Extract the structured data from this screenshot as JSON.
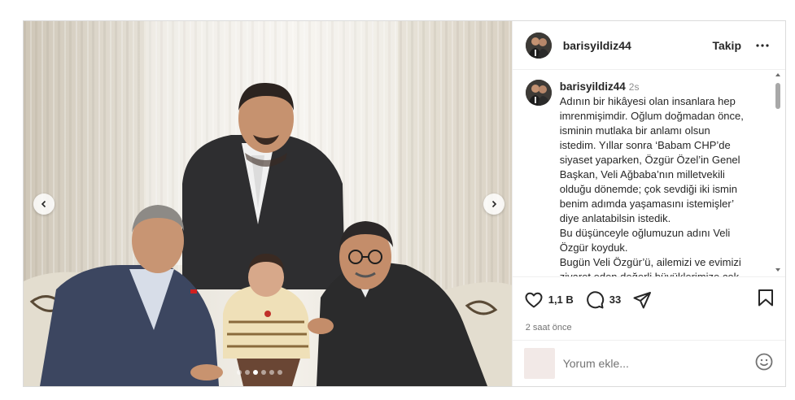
{
  "post": {
    "username": "barisyildiz44",
    "follow_label": "Takip",
    "more_label": "more-options"
  },
  "caption": {
    "username": "barisyildiz44",
    "time": "2s",
    "lines": [
      "Adının bir hikâyesi olan insanlara hep",
      "imrenmişimdir. Oğlum doğmadan önce,",
      "isminin mutlaka bir anlamı olsun",
      "istedim. Yıllar sonra ‘Babam CHP’de",
      "siyaset yaparken, Özgür Özel’in Genel",
      "Başkan, Veli Ağbaba’nın milletvekili",
      "olduğu dönemde; çok sevdiği iki ismin",
      "benim adımda yaşamasını istemişler’",
      "diye anlatabilsin istedik.",
      "Bu düşünceyle oğlumuzun adını Veli",
      "Özgür koyduk.",
      "Bugün Veli Özgür’ü, ailemizi ve evimizi",
      "ziyaret eden değerli büyüklerimize çok"
    ]
  },
  "actions": {
    "likes": "1,1 B",
    "comments": "33",
    "time_ago": "2 saat önce"
  },
  "comment": {
    "placeholder": "Yorum ekle..."
  },
  "carousel": {
    "dot_count": 6,
    "active_index": 2
  },
  "icons": {
    "like": "heart-icon",
    "comment": "comment-icon",
    "share": "share-icon",
    "save": "bookmark-icon",
    "emoji": "emoji-icon",
    "more": "ellipsis-icon",
    "prev": "chevron-left-icon",
    "next": "chevron-right-icon"
  }
}
